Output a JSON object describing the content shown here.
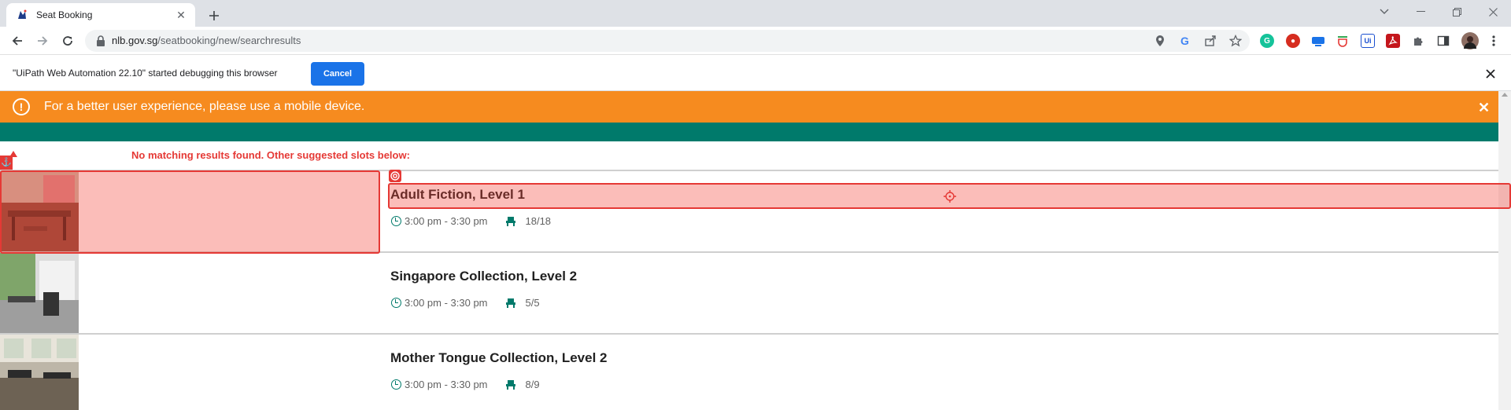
{
  "browser": {
    "tab_title": "Seat Booking",
    "url_host": "nlb.gov.sg",
    "url_path": "/seatbooking/new/searchresults"
  },
  "infobar": {
    "message": "\"UiPath Web Automation 22.10\" started debugging this browser",
    "cancel_label": "Cancel"
  },
  "page": {
    "alert_text": "For a better user experience, please use a mobile device.",
    "no_match_text": "No matching results found. Other suggested slots below:",
    "results": [
      {
        "name": "Adult Fiction, Level 1",
        "time": "3:00 pm - 3:30 pm",
        "seats": "18/18"
      },
      {
        "name": "Singapore Collection, Level 2",
        "time": "3:00 pm - 3:30 pm",
        "seats": "5/5"
      },
      {
        "name": "Mother Tongue Collection, Level 2",
        "time": "3:00 pm - 3:30 pm",
        "seats": "8/9"
      }
    ]
  },
  "colors": {
    "alert": "#f68b1f",
    "teal": "#007a6b",
    "error": "#e53935",
    "button": "#1a73e8"
  },
  "icons": {
    "favicon": "nlb-favicon-icon",
    "alert": "exclamation-circle-icon",
    "time": "clock-icon",
    "seats": "seat-icon"
  }
}
